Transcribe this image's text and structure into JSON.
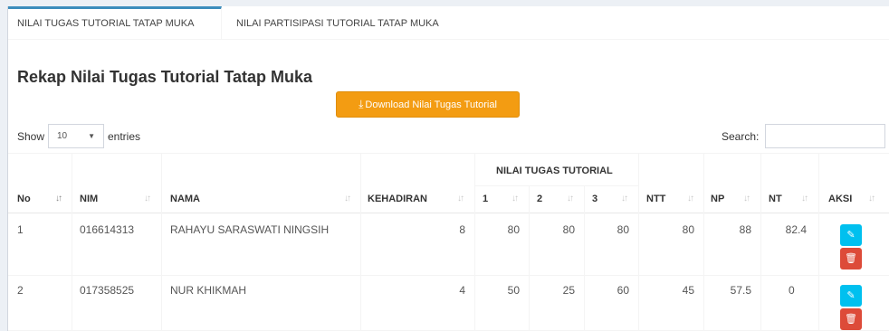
{
  "tabs": [
    {
      "label": "NILAI TUGAS TUTORIAL TATAP MUKA",
      "active": true
    },
    {
      "label": "NILAI PARTISIPASI TUTORIAL TATAP MUKA",
      "active": false
    }
  ],
  "title": "Rekap Nilai Tugas Tutorial Tatap Muka",
  "download_label": "Download Nilai Tugas Tutorial",
  "length": {
    "show": "Show",
    "value": "10",
    "entries": "entries"
  },
  "search_label": "Search:",
  "colors": {
    "accent": "#3c8dbc",
    "download": "#f39c12",
    "edit": "#00c0ef",
    "delete": "#dd4b39"
  },
  "headers": {
    "group": "NILAI TUGAS TUTORIAL",
    "no": "No",
    "nim": "NIM",
    "nama": "NAMA",
    "kehadiran": "KEHADIRAN",
    "t1": "1",
    "t2": "2",
    "t3": "3",
    "ntt": "NTT",
    "np": "NP",
    "nt": "NT",
    "aksi": "AKSI"
  },
  "rows": [
    {
      "no": "1",
      "nim": "016614313",
      "nama": "RAHAYU SARASWATI NINGSIH",
      "kehadiran": "8",
      "t1": "80",
      "t2": "80",
      "t3": "80",
      "ntt": "80",
      "np": "88",
      "nt": "82.4"
    },
    {
      "no": "2",
      "nim": "017358525",
      "nama": "NUR KHIKMAH",
      "kehadiran": "4",
      "t1": "50",
      "t2": "25",
      "t3": "60",
      "ntt": "45",
      "np": "57.5",
      "nt": "0"
    }
  ]
}
